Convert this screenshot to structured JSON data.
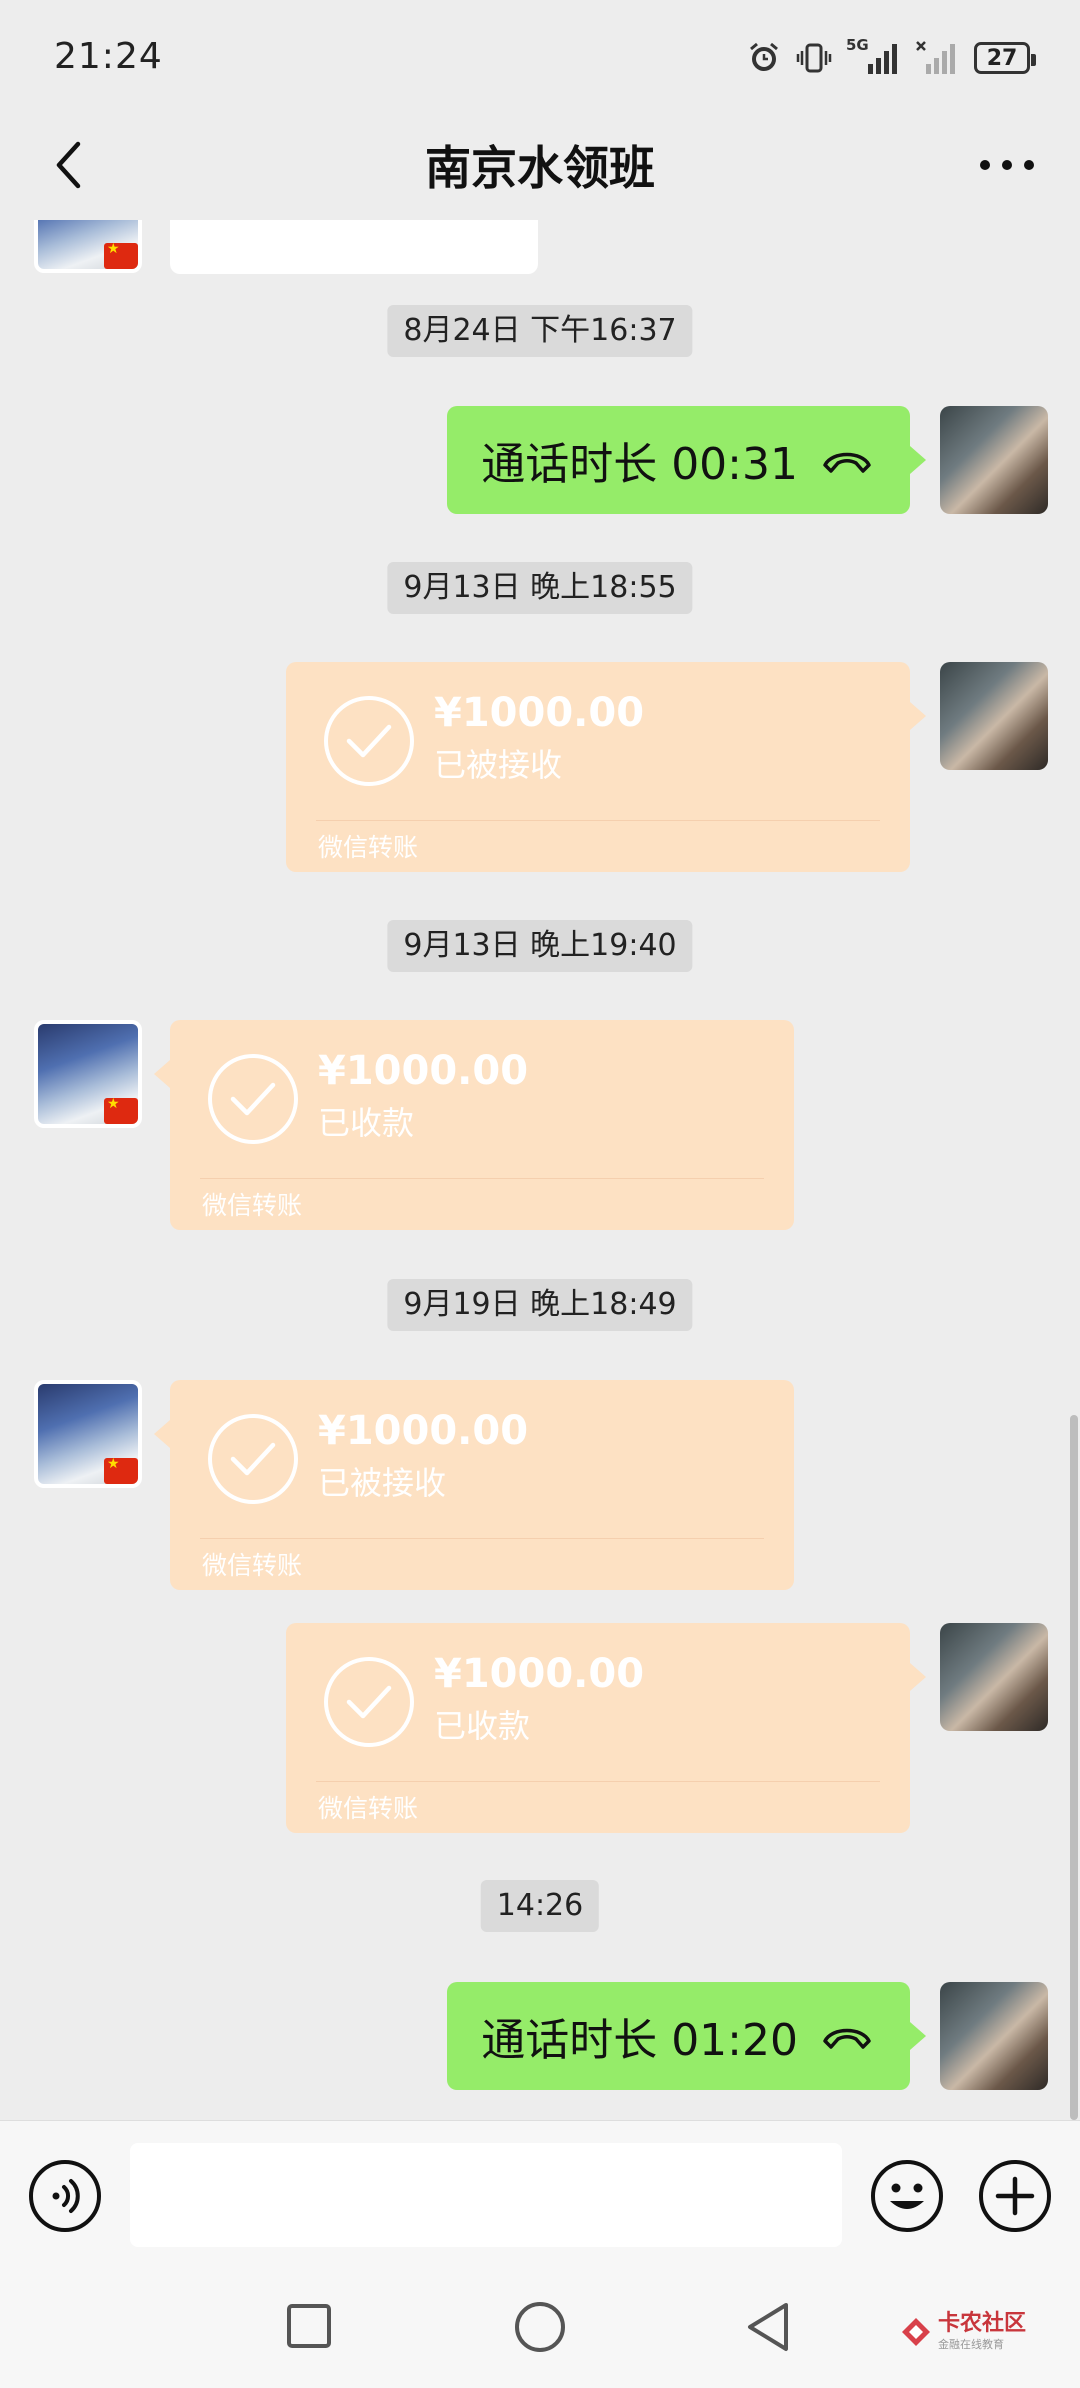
{
  "status_bar": {
    "time": "21:24",
    "network": "5G",
    "battery": "27"
  },
  "header": {
    "title": "南京水领班"
  },
  "messages": [
    {
      "type": "timestamp",
      "text": "8月24日 下午16:37"
    },
    {
      "type": "call",
      "side": "right",
      "text": "通话时长 00:31"
    },
    {
      "type": "timestamp",
      "text": "9月13日 晚上18:55"
    },
    {
      "type": "transfer",
      "side": "right",
      "amount": "¥1000.00",
      "status": "已被接收",
      "label": "微信转账"
    },
    {
      "type": "timestamp",
      "text": "9月13日 晚上19:40"
    },
    {
      "type": "transfer",
      "side": "left",
      "amount": "¥1000.00",
      "status": "已收款",
      "label": "微信转账"
    },
    {
      "type": "timestamp",
      "text": "9月19日 晚上18:49"
    },
    {
      "type": "transfer",
      "side": "left",
      "amount": "¥1000.00",
      "status": "已被接收",
      "label": "微信转账"
    },
    {
      "type": "transfer",
      "side": "right",
      "amount": "¥1000.00",
      "status": "已收款",
      "label": "微信转账"
    },
    {
      "type": "timestamp",
      "text": "14:26"
    },
    {
      "type": "call",
      "side": "right",
      "text": "通话时长 01:20"
    }
  ],
  "input": {
    "value": "",
    "placeholder": ""
  },
  "watermark": {
    "title": "卡农社区",
    "subtitle": "金融在线教育"
  },
  "colors": {
    "background": "#ededed",
    "call_bubble": "#95ec69",
    "transfer_bubble": "#fde1c3"
  }
}
